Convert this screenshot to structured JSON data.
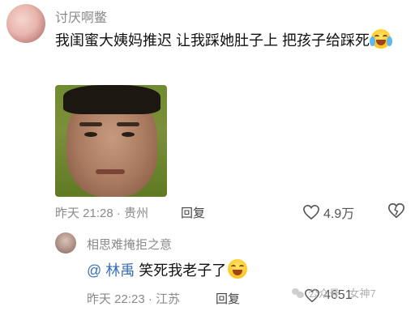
{
  "comment1": {
    "username": "讨厌啊鳖",
    "text": "我闺蜜大姨妈推迟 让我踩她肚子上 把孩子给踩死",
    "emoji": "laughing-crying-emoji",
    "time": "昨天 21:28",
    "location": "贵州",
    "reply_label": "回复",
    "likes": "4.9万"
  },
  "comment2": {
    "username": "相思难掩拒之意",
    "mention": "@ 林禹",
    "text": "笑死我老子了",
    "emoji": "grinning-emoji",
    "time": "昨天 22:23",
    "location": "江苏",
    "reply_label": "回复",
    "likes": "4651"
  },
  "watermark": "公众号 · 女神7"
}
